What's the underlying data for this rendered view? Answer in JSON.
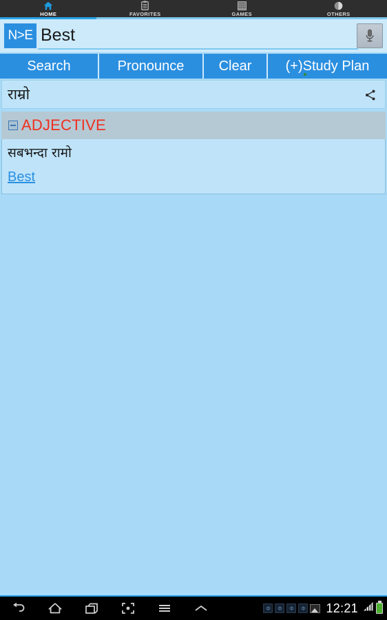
{
  "tabs": [
    {
      "label": "HOME",
      "icon": "home-icon",
      "active": true
    },
    {
      "label": "FAVORITES",
      "icon": "clipboard-icon",
      "active": false
    },
    {
      "label": "GAMES",
      "icon": "abacus-icon",
      "active": false
    },
    {
      "label": "OTHERS",
      "icon": "pie-circle-icon",
      "active": false
    }
  ],
  "search": {
    "lang_toggle_label": "N>E",
    "value": "Best",
    "placeholder": "",
    "mic_icon": "microphone-icon"
  },
  "actions": {
    "search_label": "Search",
    "pronounce_label": "Pronounce",
    "clear_label": "Clear",
    "study_plan_label": "(+)Study Plan"
  },
  "result": {
    "headword": "राम्रो",
    "share_icon": "share-icon",
    "pos_label": "ADJECTIVE",
    "collapse_icon": "minus-square-icon",
    "definition_nepali": "सबभन्दा रामो",
    "definition_link": "Best"
  },
  "system": {
    "nav": [
      {
        "name": "back-icon",
        "glyph": "↩"
      },
      {
        "name": "home-icon",
        "glyph": "⌂"
      },
      {
        "name": "recent-apps-icon",
        "glyph": "❐"
      },
      {
        "name": "screenshot-icon",
        "glyph": "⛶"
      },
      {
        "name": "menu-icon",
        "glyph": "☰"
      },
      {
        "name": "chevron-up-icon",
        "glyph": "︿"
      }
    ],
    "notifications": [
      "app-badge",
      "app-badge",
      "app-badge",
      "app-badge"
    ],
    "picture_icon": "image-icon",
    "time": "12:21",
    "signal_icon": "signal-bars-icon",
    "battery_icon": "battery-icon"
  },
  "colors": {
    "accent_blue": "#2b8fe0",
    "page_bg": "#a8daf7",
    "tabbar_bg": "#2e2e2e",
    "pos_red": "#ef3020",
    "pos_header_bg": "#b5c9d4"
  }
}
